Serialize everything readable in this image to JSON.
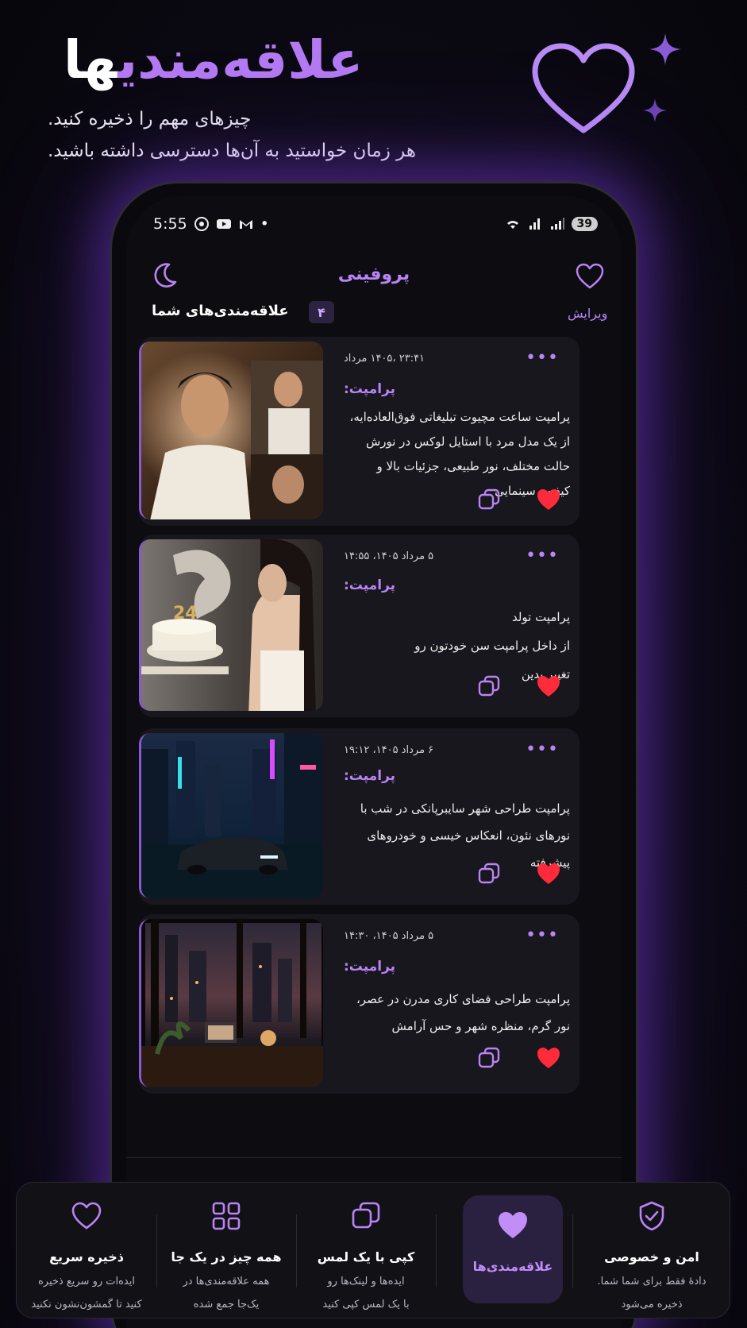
{
  "hero": {
    "title_white": "ها",
    "title_purple": "علاقه‌مندی",
    "subtitle_1": "چیزهای مهم را ذخیره کنید.",
    "subtitle_2": "هر زمان خواستید به آن‌ها دسترسی داشته باشید."
  },
  "status_bar": {
    "time": "5:55",
    "dot": "•",
    "battery": "39"
  },
  "app": {
    "title": "پروفینی",
    "edit_label": "ویرایش",
    "favorites_label": "علاقه‌مندی‌های شما",
    "favorites_count": "۴"
  },
  "cards": [
    {
      "date": "۲۳:۴۱ ،۱۴۰۵ مرداد",
      "prompt_label": "پرامپت:",
      "text": "پرامپت ساعت مچیوت تبلیغاتی فوق‌العاده‌ایه، از یک مدل مرد با استایل لوکس در نورش حالت مختلف، نور طبیعی، جزئیات بالا و کیفیت سینمایی",
      "menu": "•••"
    },
    {
      "date": "۵ مرداد ۱۴۰۵، ۱۴:۵۵",
      "prompt_label": "پرامپت:",
      "text": "پرامپت تولد\nاز داخل پرامپت سن خودتون رو\nتغییر بدین",
      "menu": "•••"
    },
    {
      "date": "۶ مرداد ۱۴۰۵، ۱۹:۱۲",
      "prompt_label": "پرامپت:",
      "text": "پرامپت طراحی شهر سایبرپانکی در شب با نورهای نئون، انعکاس خیسی و خودروهای پیشرفته",
      "menu": "•••"
    },
    {
      "date": "۵ مرداد ۱۴۰۵، ۱۴:۳۰",
      "prompt_label": "پرامپت:",
      "text": "پرامپت طراحی فضای کاری مدرن در عصر، نور گرم، منظره شهر و حس آرامش",
      "menu": "•••"
    }
  ],
  "bottom_nav": [
    {
      "label": "امن و خصوصی",
      "desc": "دادهٔ فقط برای شما شما.\nذخیره می‌شود",
      "icon": "shield-check-icon"
    },
    {
      "label": "علاقه‌مندی‌ها",
      "desc": "",
      "icon": "heart-filled-icon"
    },
    {
      "label": "کپی با یک لمس",
      "desc": "ایده‌ها و لینک‌ها رو\nبا یک لمس کپی کنید",
      "icon": "copy-icon"
    },
    {
      "label": "همه چیز در یک جا",
      "desc": "همه علاقه‌مندی‌ها در\nیک‌جا جمع شده",
      "icon": "grid-icon"
    },
    {
      "label": "ذخیره سریع",
      "desc": "ایده‌ات رو سریع ذخیره\nکنید تا گمشون‌نشون نکنید",
      "icon": "heart-outline-icon"
    }
  ],
  "colors": {
    "accent": "#b984f6",
    "like": "#ff2a3a",
    "background": "#0c0a14"
  }
}
